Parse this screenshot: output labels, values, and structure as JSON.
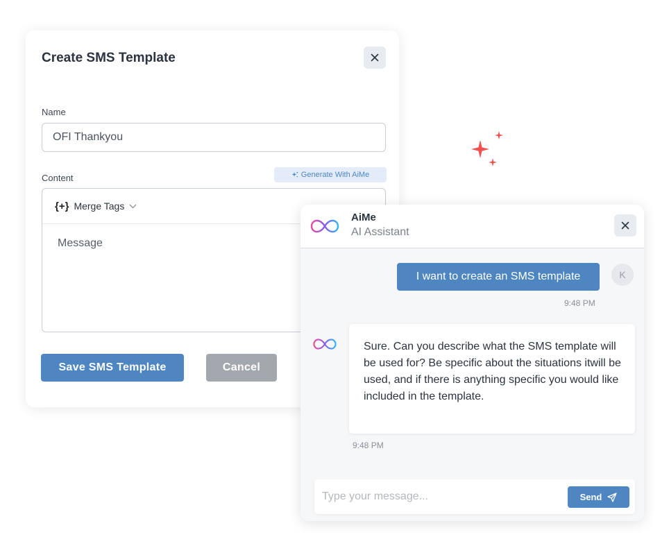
{
  "sms_modal": {
    "title": "Create SMS Template",
    "name_label": "Name",
    "name_value": "OFI Thankyou",
    "content_label": "Content",
    "generate_label": "Generate With AiMe",
    "merge_glyph": "{+}",
    "merge_label": "Merge Tags",
    "message_placeholder": "Message",
    "save_label": "Save SMS Template",
    "cancel_label": "Cancel",
    "close_icon": "close-icon"
  },
  "chat": {
    "assistant_name": "AiMe",
    "assistant_role": "AI Assistant",
    "logo_icon": "infinity-icon",
    "messages": [
      {
        "sender": "user",
        "avatar": "K",
        "text": "I want to create an SMS template",
        "time": "9:48 PM"
      },
      {
        "sender": "assistant",
        "text": "Sure. Can you describe what the SMS template will be used for? Be specific about the situations itwill be used, and if there is anything specific you would like included in the template.",
        "time": "9:48 PM"
      }
    ],
    "input_placeholder": "Type your message...",
    "send_label": "Send",
    "send_icon": "paper-plane-icon"
  },
  "colors": {
    "primary": "#4e86c2",
    "cancel": "#a3a7ae",
    "sparkle": "#f0524f"
  }
}
